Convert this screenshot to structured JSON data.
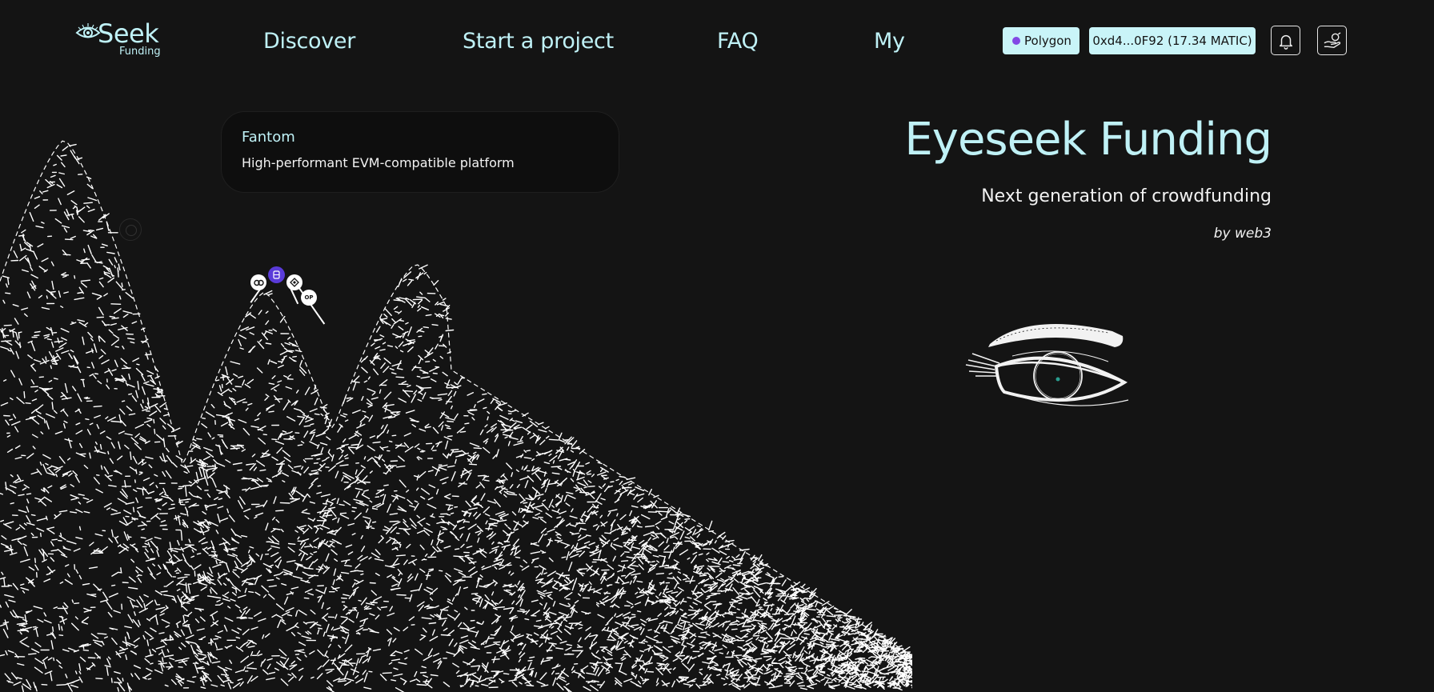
{
  "header": {
    "logo_word": "Seek",
    "logo_sub": "Funding",
    "nav": {
      "discover": "Discover",
      "start_project": "Start a project",
      "faq": "FAQ",
      "my": "My"
    },
    "network_label": "Polygon",
    "wallet_label": "0xd4...0F92 (17.34 MATIC)"
  },
  "card": {
    "title": "Fantom",
    "description": "High-performant EVM-compatible platform"
  },
  "hero": {
    "title": "Eyeseek Funding",
    "subtitle": "Next generation of crowdfunding",
    "byline": "by web3"
  },
  "chains": {
    "optimism_label": "OP"
  },
  "colors": {
    "background": "#141414",
    "accent": "#bff1f6",
    "pill_bg": "#c9f4f8",
    "polygon": "#8247e5",
    "active_chain": "#5a3bd9"
  },
  "icons": [
    "eye-logo-icon",
    "polygon-icon",
    "bell-icon",
    "hand-coin-icon",
    "chain-link-icon",
    "fantom-icon",
    "binance-icon",
    "optimism-icon"
  ]
}
